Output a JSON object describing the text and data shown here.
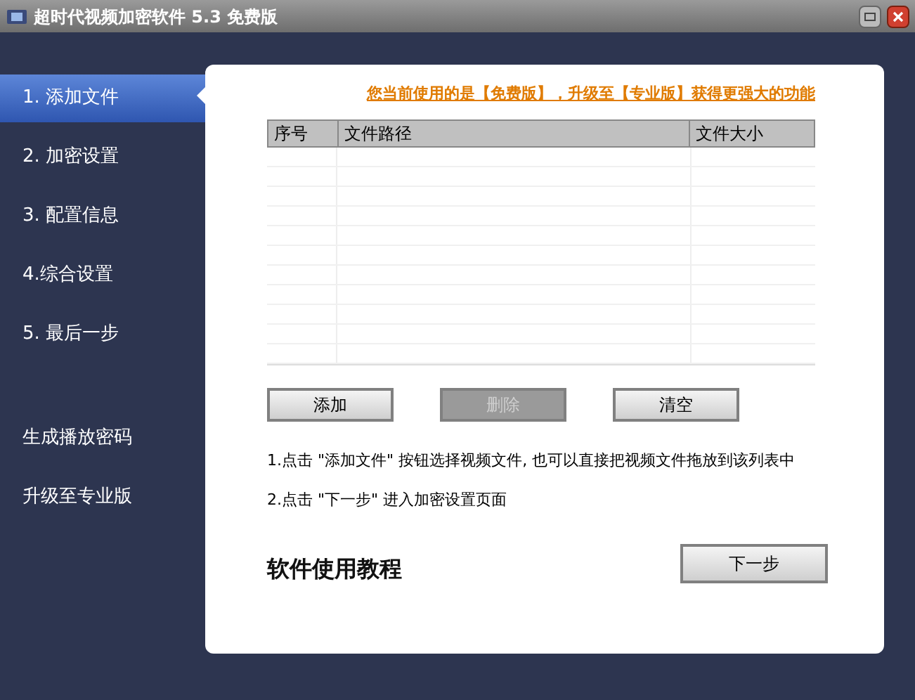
{
  "window": {
    "title": "超时代视频加密软件 5.3  免费版"
  },
  "sidebar": {
    "items": [
      {
        "label": "1. 添加文件",
        "selected": true
      },
      {
        "label": "2. 加密设置",
        "selected": false
      },
      {
        "label": "3. 配置信息",
        "selected": false
      },
      {
        "label": "4.综合设置",
        "selected": false
      },
      {
        "label": "5. 最后一步",
        "selected": false
      }
    ],
    "links": [
      "生成播放密码",
      "升级至专业版"
    ]
  },
  "banner": "您当前使用的是【免费版】，升级至【专业版】获得更强大的功能",
  "table": {
    "columns": [
      "序号",
      "文件路径",
      "文件大小"
    ]
  },
  "buttons": [
    {
      "label": "添加",
      "disabled": false
    },
    {
      "label": "删除",
      "disabled": true
    },
    {
      "label": "清空",
      "disabled": false
    }
  ],
  "instructions": [
    "1.点击 \"添加文件\" 按钮选择视频文件, 也可以直接把视频文件拖放到该列表中",
    "2.点击 \"下一步\" 进入加密设置页面"
  ],
  "tutorial_heading": "软件使用教程",
  "next_button": "下一步"
}
